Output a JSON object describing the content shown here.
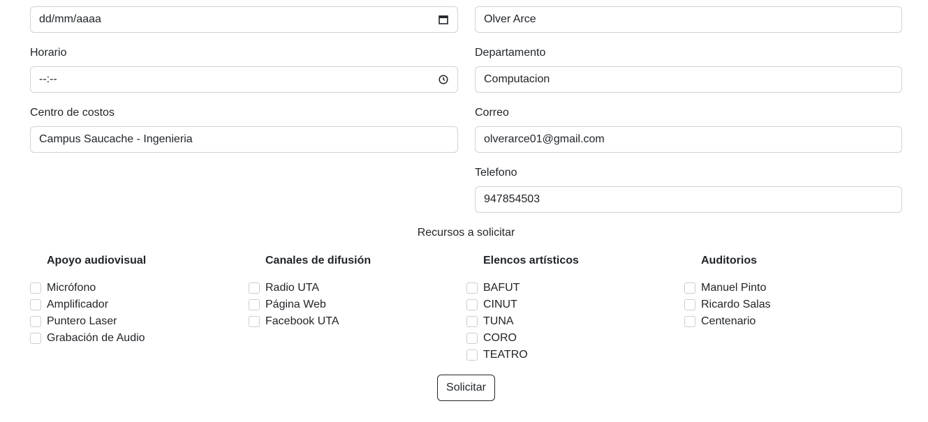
{
  "left_form": {
    "date_field": {
      "value": "dd/mm/aaaa",
      "icon": "calendar-icon"
    },
    "horario": {
      "label": "Horario",
      "value": "--:--",
      "icon": "clock-icon"
    },
    "centro_costos": {
      "label": "Centro de costos",
      "value": "Campus Saucache - Ingenieria"
    }
  },
  "right_form": {
    "name_field": {
      "value": "Olver Arce"
    },
    "departamento": {
      "label": "Departamento",
      "value": "Computacion"
    },
    "correo": {
      "label": "Correo",
      "value": "olverarce01@gmail.com"
    },
    "telefono": {
      "label": "Telefono",
      "value": "947854503"
    }
  },
  "resources": {
    "title": "Recursos a solicitar",
    "columns": [
      {
        "title": "Apoyo audiovisual",
        "items": [
          "Micrófono",
          "Amplificador",
          "Puntero Laser",
          "Grabación de Audio"
        ]
      },
      {
        "title": "Canales de difusión",
        "items": [
          "Radio UTA",
          "Página Web",
          "Facebook UTA"
        ]
      },
      {
        "title": "Elencos artísticos",
        "items": [
          "BAFUT",
          "CINUT",
          "TUNA",
          "CORO",
          "TEATRO"
        ]
      },
      {
        "title": "Auditorios",
        "items": [
          "Manuel Pinto",
          "Ricardo Salas",
          "Centenario"
        ]
      }
    ]
  },
  "submit_label": "Solicitar"
}
